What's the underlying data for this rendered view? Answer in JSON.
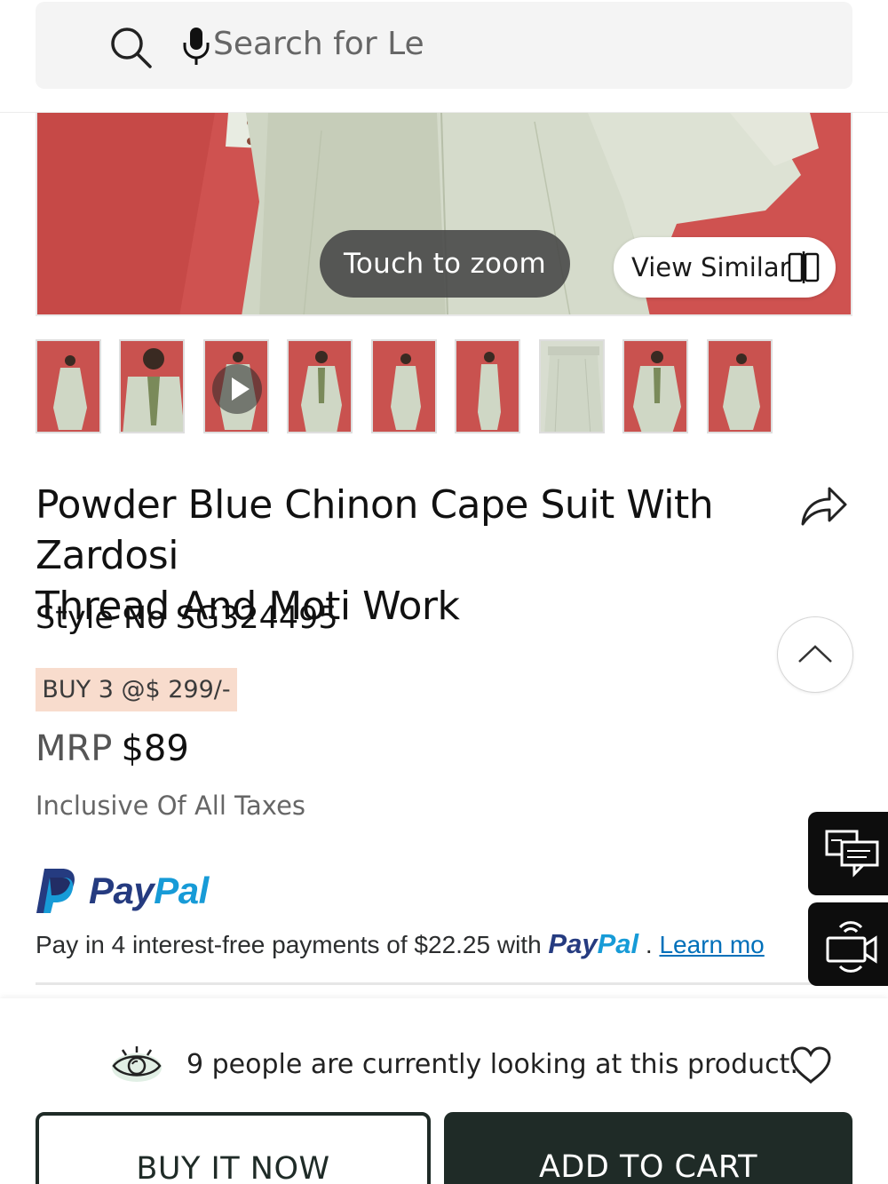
{
  "search": {
    "placeholder": "Search for Le"
  },
  "hero": {
    "zoom_label": "Touch to zoom",
    "view_similar_label": "View Similar"
  },
  "thumbnails": [
    {
      "type": "image"
    },
    {
      "type": "image"
    },
    {
      "type": "video"
    },
    {
      "type": "image"
    },
    {
      "type": "image"
    },
    {
      "type": "image"
    },
    {
      "type": "image"
    },
    {
      "type": "image"
    },
    {
      "type": "image"
    }
  ],
  "product": {
    "title_line1": "Powder Blue Chinon Cape Suit With Zardosi",
    "title_line2": "Thread And Moti Work",
    "style_no": "Style No SG324495",
    "offer": "BUY 3 @$ 299/-",
    "mrp_label": "MRP",
    "price": "$89",
    "taxes_note": "Inclusive Of All Taxes"
  },
  "paypal": {
    "logo_pay": "Pay",
    "logo_pal": "Pal",
    "message_prefix": "Pay in 4 interest-free payments of $22.25 with ",
    "inline_pay": "Pay",
    "inline_pal": "Pal",
    "message_sep": " . ",
    "learn_more": "Learn mo"
  },
  "footer": {
    "viewers_text": "9 people are currently looking at this product.",
    "buy_now_label": "BUY IT NOW",
    "add_to_cart_label": "ADD TO CART"
  },
  "icons": {
    "search": "search-icon",
    "mic": "mic-icon",
    "compare": "compare-icon",
    "share": "share-icon",
    "scroll_top": "chevron-up-icon",
    "chat": "chat-icon",
    "video_call": "video-call-icon",
    "eye": "eye-icon",
    "wishlist": "heart-icon"
  },
  "colors": {
    "primary_dark": "#1f2b27",
    "offer_bg": "#f8dccd",
    "paypal_dark": "#253b80",
    "paypal_light": "#179bd7",
    "link": "#0070ba"
  }
}
